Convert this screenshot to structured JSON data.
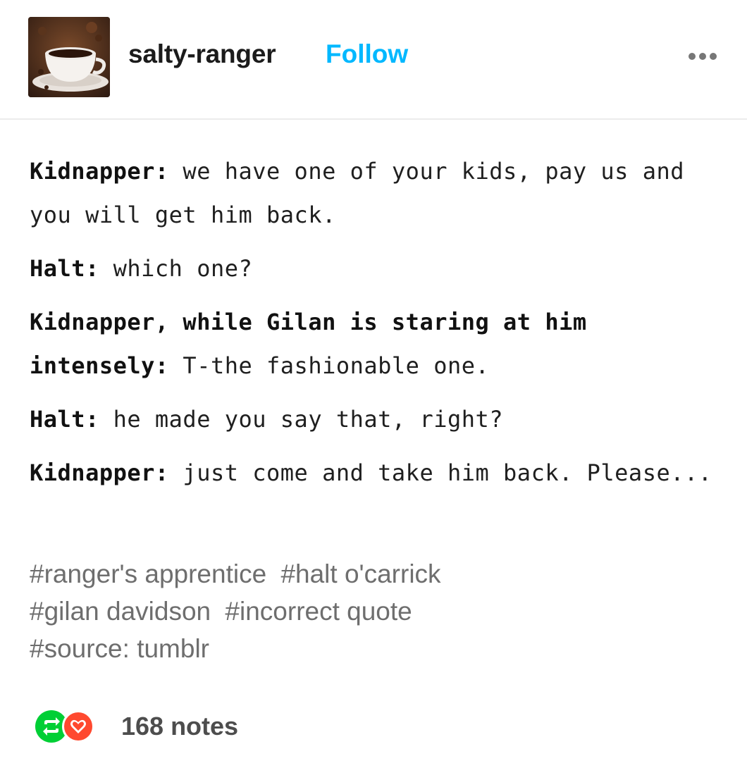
{
  "header": {
    "username": "salty-ranger",
    "follow_label": "Follow",
    "avatar_icon": "coffee-cup-avatar",
    "more_icon": "more-dots-icon"
  },
  "post": {
    "lines": [
      {
        "speaker": "Kidnapper:",
        "text": " we have one of your kids, pay us and you will get him back."
      },
      {
        "speaker": "Halt:",
        "text": " which one?"
      },
      {
        "speaker": "Kidnapper, while Gilan is staring at him intensely:",
        "text": " T-the fashionable one."
      },
      {
        "speaker": "Halt:",
        "text": " he made you say that, right?"
      },
      {
        "speaker": "Kidnapper:",
        "text": " just come and take him back. Please..."
      }
    ]
  },
  "tags": [
    "#ranger's apprentice",
    "#halt o'carrick",
    "#gilan davidson",
    "#incorrect quote",
    "#source: tumblr"
  ],
  "footer": {
    "notes_label": "168 notes",
    "reblog_icon": "reblog-icon",
    "like_icon": "heart-icon"
  },
  "colors": {
    "follow": "#00b8ff",
    "reblog": "#00cf35",
    "like": "#ff492f",
    "tags": "#6e6e6e"
  }
}
